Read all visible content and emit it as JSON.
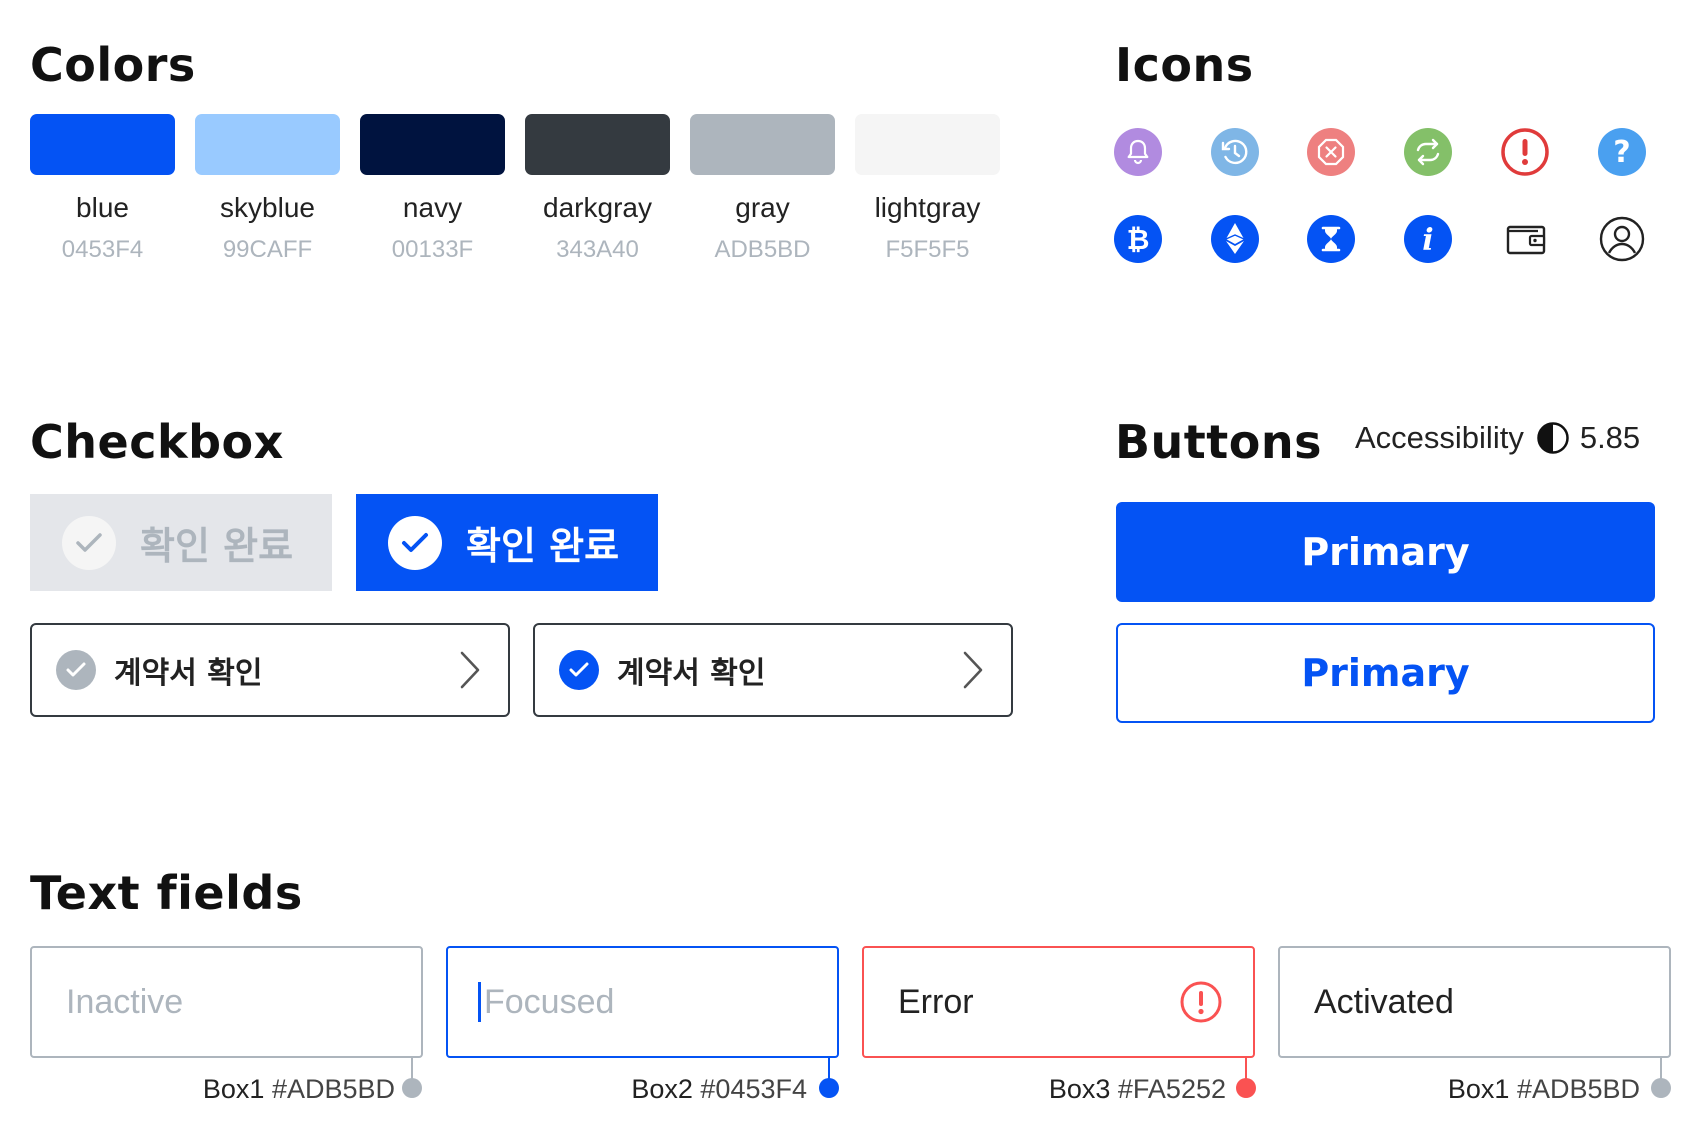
{
  "sections": {
    "colors_title": "Colors",
    "icons_title": "Icons",
    "checkbox_title": "Checkbox",
    "buttons_title": "Buttons",
    "textfields_title": "Text fields"
  },
  "colors": [
    {
      "name": "blue",
      "hex": "0453F4",
      "color": "#0453F4"
    },
    {
      "name": "skyblue",
      "hex": "99CAFF",
      "color": "#99CAFF"
    },
    {
      "name": "navy",
      "hex": "00133F",
      "color": "#00133F"
    },
    {
      "name": "darkgray",
      "hex": "343A40",
      "color": "#343A40"
    },
    {
      "name": "gray",
      "hex": "ADB5BD",
      "color": "#ADB5BD"
    },
    {
      "name": "lightgray",
      "hex": "F5F5F5",
      "color": "#F5F5F5"
    }
  ],
  "icons": {
    "row1": [
      "bell-icon",
      "clock-history-icon",
      "close-octagon-icon",
      "refresh-icon",
      "alert-icon",
      "question-icon"
    ],
    "row2": [
      "bitcoin-icon",
      "ethereum-icon",
      "hourglass-icon",
      "info-icon",
      "wallet-icon",
      "user-icon"
    ]
  },
  "checkbox": {
    "big_unchecked_label": "확인 완료",
    "big_checked_label": "확인 완료",
    "row_unchecked_label": "계약서 확인",
    "row_checked_label": "계약서 확인"
  },
  "buttons": {
    "accessibility_label": "Accessibility",
    "accessibility_value": "5.85",
    "primary_label": "Primary",
    "outline_label": "Primary"
  },
  "textfields": [
    {
      "state": "inactive",
      "text": "Inactive",
      "note_box": "Box1",
      "note_hex": "#ADB5BD",
      "color": "#ADB5BD"
    },
    {
      "state": "focused",
      "text": "Focused",
      "note_box": "Box2",
      "note_hex": "#0453F4",
      "color": "#0453F4"
    },
    {
      "state": "error",
      "text": "Error",
      "note_box": "Box3",
      "note_hex": "#FA5252",
      "color": "#FA5252"
    },
    {
      "state": "activated",
      "text": "Activated",
      "note_box": "Box1",
      "note_hex": "#ADB5BD",
      "color": "#ADB5BD"
    }
  ]
}
